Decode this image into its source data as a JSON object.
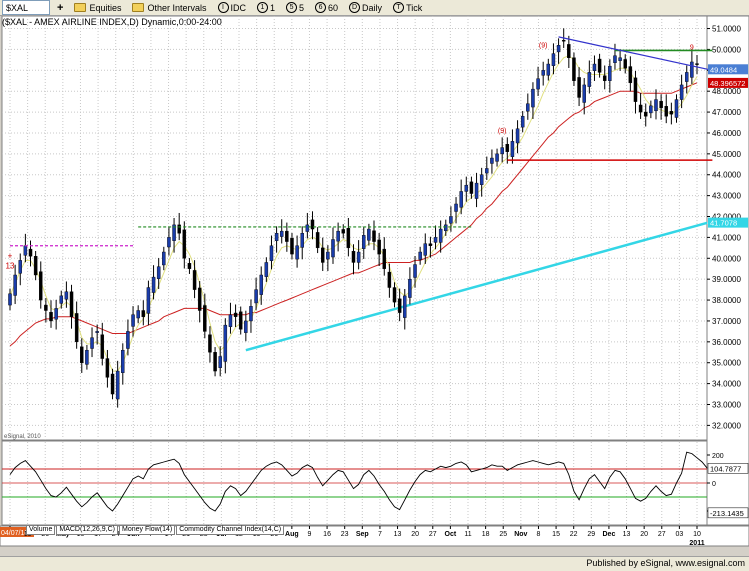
{
  "toolbar": {
    "symbol": "$XAL",
    "equities": "Equities",
    "other_intervals": "Other Intervals",
    "idc": "IDC",
    "b1": "1",
    "b5": "5",
    "b60": "60",
    "daily": "Daily",
    "tick": "Tick"
  },
  "title": "($XAL - AMEX AIRLINE INDEX,D) Dynamic,0:00-24:00",
  "watermark": "eSignal, 2010",
  "footer": "Published by eSignal, www.esignal.com",
  "tabs": [
    "Volume",
    "MACD(12,26,9,C)",
    "Money Flow(14)",
    "Commodity Channel Index(14,C)"
  ],
  "colors": {
    "background": "#ffffff",
    "up_candle": "#1a3caa",
    "down_candle": "#000000",
    "ma_fast": "#e0e080",
    "ma_mid": "#cc2222",
    "ma_long": "#33d6e6",
    "resistance": "#228b22",
    "support": "#d00000",
    "pink_level": "#cc22cc",
    "trendline": "#3333cc"
  },
  "chart_data": [
    {
      "type": "candlestick",
      "title": "($XAL - AMEX AIRLINE INDEX,D) Dynamic,0:00-24:00",
      "ylim": [
        31.3,
        51.6
      ],
      "y_ticks": [
        "51.0000",
        "50.0000",
        "49.0000",
        "48.0000",
        "47.0000",
        "46.0000",
        "45.0000",
        "44.0000",
        "43.0000",
        "42.0000",
        "41.0000",
        "40.0000",
        "39.0000",
        "38.0000",
        "37.0000",
        "36.0000",
        "35.0000",
        "34.0000",
        "33.0000",
        "32.0000"
      ],
      "price_labels": [
        {
          "text": "49.0484",
          "value": 49.0484,
          "color": "#4a7fd4"
        },
        {
          "text": "48.396572",
          "value": 48.397,
          "color": "#cc0000"
        },
        {
          "text": "41.7078",
          "value": 41.7078,
          "color": "#33d6e6"
        }
      ],
      "x_date_labels": [
        "04/07/10",
        "19",
        "26",
        "May",
        "10",
        "17",
        "24",
        "Jun",
        "7",
        "14",
        "21",
        "28",
        "Jul",
        "12",
        "19",
        "26",
        "Aug",
        "9",
        "16",
        "23",
        "Sep",
        "7",
        "13",
        "20",
        "27",
        "Oct",
        "11",
        "18",
        "25",
        "Nov",
        "8",
        "15",
        "22",
        "29",
        "Dec",
        "13",
        "20",
        "27",
        "03",
        "10"
      ],
      "x_year_label": "2011",
      "closes": [
        38.3,
        39.2,
        39.9,
        40.6,
        40.1,
        39.2,
        38.0,
        37.5,
        37.0,
        37.6,
        38.2,
        38.4,
        37.2,
        36.0,
        35.0,
        35.6,
        36.2,
        36.5,
        35.2,
        34.3,
        33.5,
        34.6,
        35.6,
        36.5,
        37.3,
        37.5,
        37.2,
        38.6,
        39.1,
        39.6,
        40.3,
        41.0,
        41.6,
        41.2,
        40.0,
        39.5,
        38.5,
        37.5,
        36.5,
        35.5,
        34.6,
        35.3,
        36.8,
        37.3,
        37.2,
        36.6,
        37.0,
        37.7,
        38.5,
        39.2,
        39.8,
        40.6,
        41.2,
        41.3,
        40.8,
        40.2,
        40.6,
        41.2,
        41.6,
        41.4,
        40.5,
        39.8,
        40.3,
        40.9,
        41.3,
        41.2,
        40.5,
        39.8,
        40.3,
        41.1,
        41.4,
        40.8,
        40.2,
        39.5,
        38.6,
        37.9,
        37.4,
        38.2,
        39.0,
        39.7,
        40.3,
        40.7,
        40.6,
        41.0,
        41.4,
        41.6,
        42.0,
        42.6,
        43.2,
        43.5,
        43.1,
        43.6,
        44.0,
        44.3,
        44.8,
        45.0,
        45.3,
        45.1,
        45.6,
        46.2,
        46.8,
        47.4,
        48.1,
        48.6,
        49.0,
        49.3,
        49.8,
        50.2,
        50.4,
        49.6,
        48.5,
        47.7,
        48.3,
        48.9,
        49.3,
        48.9,
        48.5,
        49.2,
        49.7,
        49.6,
        49.1,
        48.4,
        47.5,
        47.0,
        46.8,
        47.3,
        47.6,
        47.2,
        46.8,
        46.9,
        47.6,
        48.3,
        48.9,
        49.4,
        49.3
      ],
      "ma_fast": [
        38.2,
        38.8,
        39.4,
        39.9,
        39.9,
        39.5,
        38.9,
        38.2,
        37.6,
        37.5,
        37.7,
        37.9,
        37.7,
        37.0,
        36.2,
        35.9,
        35.9,
        36.0,
        35.8,
        35.2,
        34.6,
        34.6,
        35.0,
        35.6,
        36.3,
        36.8,
        37.1,
        37.6,
        38.2,
        38.7,
        39.3,
        39.9,
        40.5,
        40.8,
        40.6,
        40.2,
        39.6,
        38.8,
        37.9,
        36.9,
        36.0,
        35.6,
        35.8,
        36.3,
        36.7,
        36.9,
        36.9,
        37.1,
        37.6,
        38.2,
        38.8,
        39.5,
        40.1,
        40.5,
        40.6,
        40.5,
        40.4,
        40.6,
        40.9,
        41.0,
        40.9,
        40.5,
        40.4,
        40.5,
        40.7,
        40.9,
        40.8,
        40.5,
        40.4,
        40.5,
        40.7,
        40.7,
        40.5,
        40.1,
        39.6,
        38.9,
        38.4,
        38.2,
        38.4,
        38.8,
        39.3,
        39.8,
        40.2,
        40.5,
        40.8,
        41.2,
        41.5,
        41.9,
        42.3,
        42.7,
        42.9,
        43.1,
        43.3,
        43.6,
        43.9,
        44.3,
        44.6,
        44.8,
        45.1,
        45.4,
        45.8,
        46.3,
        46.8,
        47.3,
        47.9,
        48.4,
        48.9,
        49.3,
        49.6,
        49.7,
        49.5,
        49.1,
        48.9,
        48.8,
        48.8,
        48.8,
        48.8,
        48.9,
        49.0,
        49.1,
        49.1,
        48.9,
        48.5,
        48.1,
        47.6,
        47.3,
        47.2,
        47.1,
        47.0,
        46.9,
        47.1,
        47.4,
        47.8,
        48.3,
        48.7
      ],
      "ma_mid": [
        35.8,
        36.0,
        36.3,
        36.5,
        36.7,
        36.9,
        37.0,
        37.1,
        37.1,
        37.2,
        37.2,
        37.2,
        37.2,
        37.1,
        37.0,
        36.9,
        36.8,
        36.7,
        36.6,
        36.5,
        36.4,
        36.4,
        36.4,
        36.4,
        36.5,
        36.6,
        36.7,
        36.8,
        36.9,
        37.0,
        37.2,
        37.3,
        37.4,
        37.5,
        37.6,
        37.6,
        37.6,
        37.6,
        37.6,
        37.5,
        37.4,
        37.3,
        37.3,
        37.3,
        37.3,
        37.3,
        37.3,
        37.4,
        37.4,
        37.5,
        37.6,
        37.7,
        37.8,
        37.9,
        38.0,
        38.1,
        38.2,
        38.3,
        38.4,
        38.5,
        38.6,
        38.7,
        38.8,
        38.9,
        39.0,
        39.1,
        39.2,
        39.3,
        39.3,
        39.4,
        39.5,
        39.6,
        39.7,
        39.8,
        39.8,
        39.8,
        39.8,
        39.8,
        39.8,
        39.9,
        39.9,
        40.0,
        40.1,
        40.2,
        40.4,
        40.6,
        40.8,
        41.0,
        41.2,
        41.4,
        41.6,
        41.9,
        42.1,
        42.4,
        42.6,
        42.9,
        43.2,
        43.4,
        43.7,
        44.0,
        44.3,
        44.6,
        44.9,
        45.2,
        45.5,
        45.8,
        46.0,
        46.3,
        46.5,
        46.7,
        46.9,
        47.0,
        47.2,
        47.3,
        47.5,
        47.6,
        47.7,
        47.8,
        47.9,
        48.0,
        48.0,
        48.0,
        48.0,
        47.9,
        47.9,
        47.9,
        47.9,
        47.9,
        47.9,
        47.9,
        48.0,
        48.1,
        48.2,
        48.3,
        48.4
      ],
      "ma_long_segment": {
        "start_index": 46,
        "end_index": 136,
        "start_value": 35.6,
        "end_value": 41.7
      },
      "lines": [
        {
          "name": "pink-level",
          "value": 40.6,
          "from": 0,
          "to": 24,
          "style": "dashed"
        },
        {
          "name": "green-resistance-1",
          "value": 41.5,
          "from": 25,
          "to": 90,
          "style": "dashed"
        },
        {
          "name": "red-support",
          "value": 44.7,
          "from": 97,
          "to": 137,
          "style": "solid"
        },
        {
          "name": "green-resistance-2",
          "value": 49.95,
          "from": 118,
          "to": 137,
          "style": "solid"
        },
        {
          "name": "blue-trendline",
          "value_from": 50.6,
          "value_to": 49.0,
          "from": 107,
          "to": 137,
          "style": "solid"
        }
      ],
      "sequential_marks": [
        {
          "index": 96,
          "text": "(9)",
          "value": 46.0
        },
        {
          "index": 104,
          "text": "(9)",
          "value": 50.1
        },
        {
          "index": 133,
          "text": "9",
          "value": 50.0
        }
      ],
      "left_marks": [
        {
          "text": "+",
          "value": 40.0
        },
        {
          "text": "13",
          "value": 39.5
        }
      ]
    },
    {
      "type": "line",
      "name": "Commodity Channel Index(14,C)",
      "ylim": [
        -300,
        300
      ],
      "y_ticks": [
        "200",
        "0",
        "-200"
      ],
      "levels": [
        100,
        -100
      ],
      "price_labels": [
        {
          "text": "104.7877",
          "value": 104.7877
        },
        {
          "text": "-213.1435",
          "value": -213.1435
        }
      ],
      "values": [
        60,
        110,
        140,
        160,
        120,
        80,
        20,
        -40,
        -90,
        -100,
        -70,
        -30,
        -80,
        -130,
        -170,
        -140,
        -100,
        -70,
        -120,
        -170,
        -200,
        -150,
        -90,
        -30,
        30,
        50,
        30,
        100,
        130,
        140,
        150,
        160,
        170,
        140,
        60,
        10,
        -40,
        -90,
        -140,
        -180,
        -200,
        -150,
        -60,
        -20,
        -40,
        -90,
        -60,
        -10,
        40,
        90,
        120,
        140,
        150,
        130,
        90,
        50,
        70,
        110,
        130,
        110,
        40,
        -20,
        20,
        60,
        90,
        80,
        20,
        -40,
        -10,
        60,
        90,
        50,
        -10,
        -60,
        -120,
        -170,
        -190,
        -120,
        -50,
        10,
        60,
        90,
        80,
        100,
        120,
        110,
        120,
        140,
        150,
        130,
        80,
        90,
        100,
        110,
        130,
        120,
        120,
        90,
        110,
        130,
        140,
        150,
        160,
        150,
        140,
        130,
        140,
        150,
        140,
        60,
        -60,
        -120,
        -40,
        30,
        60,
        10,
        -40,
        40,
        90,
        80,
        30,
        -40,
        -110,
        -130,
        -110,
        -60,
        -20,
        -60,
        -90,
        -80,
        0,
        70,
        220,
        210,
        180,
        150,
        105
      ]
    }
  ]
}
